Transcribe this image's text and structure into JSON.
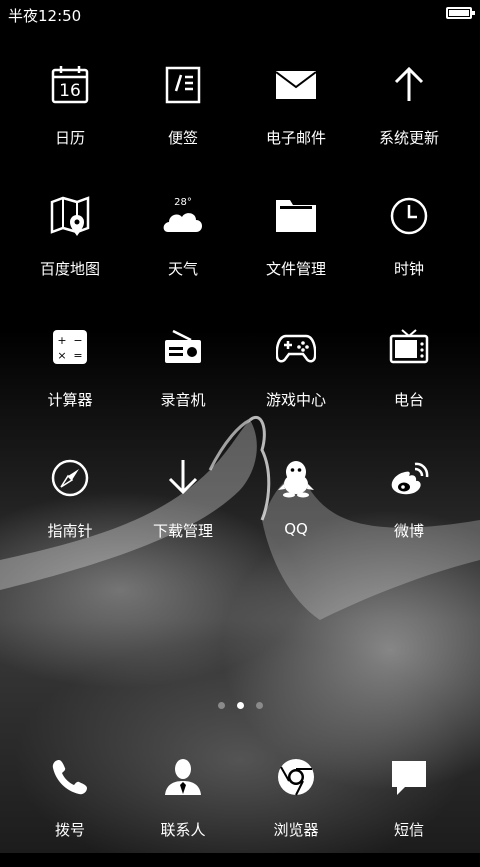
{
  "status_bar": {
    "time": "半夜12:50",
    "battery_level": 1.0
  },
  "home_grid": [
    {
      "label": "日历",
      "icon": "calendar-icon",
      "date": "16"
    },
    {
      "label": "便签",
      "icon": "note-icon"
    },
    {
      "label": "电子邮件",
      "icon": "mail-icon"
    },
    {
      "label": "系统更新",
      "icon": "arrow-up-icon"
    },
    {
      "label": "百度地图",
      "icon": "map-icon"
    },
    {
      "label": "天气",
      "icon": "weather-icon",
      "temperature": "28°"
    },
    {
      "label": "文件管理",
      "icon": "folder-icon"
    },
    {
      "label": "时钟",
      "icon": "clock-icon"
    },
    {
      "label": "计算器",
      "icon": "calculator-icon"
    },
    {
      "label": "录音机",
      "icon": "radio-icon"
    },
    {
      "label": "游戏中心",
      "icon": "gamepad-icon"
    },
    {
      "label": "电台",
      "icon": "tv-icon"
    },
    {
      "label": "指南针",
      "icon": "compass-icon"
    },
    {
      "label": "下载管理",
      "icon": "arrow-down-icon"
    },
    {
      "label": "QQ",
      "icon": "penguin-icon"
    },
    {
      "label": "微博",
      "icon": "weibo-icon"
    }
  ],
  "page_indicator": {
    "pages": 3,
    "current": 2
  },
  "dock": [
    {
      "label": "拨号",
      "icon": "phone-icon"
    },
    {
      "label": "联系人",
      "icon": "contact-icon"
    },
    {
      "label": "浏览器",
      "icon": "browser-icon"
    },
    {
      "label": "短信",
      "icon": "message-icon"
    }
  ]
}
